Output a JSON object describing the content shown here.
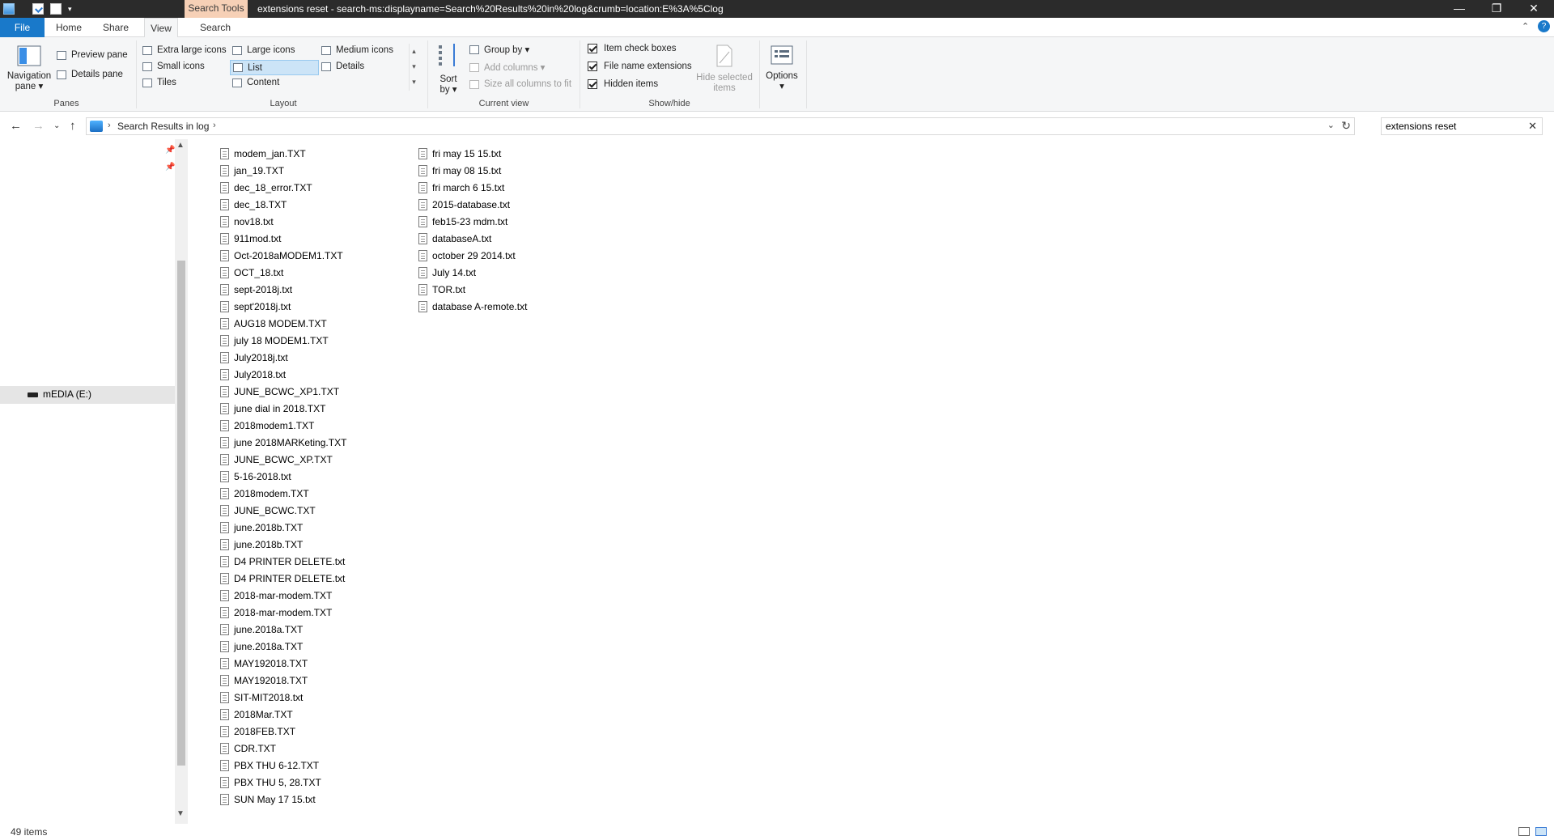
{
  "window": {
    "context_tab": "Search Tools",
    "title": "extensions reset - search-ms:displayname=Search%20Results%20in%20log&crumb=location:E%3A%5Clog",
    "minimize": "—",
    "restore": "❐",
    "close": "✕"
  },
  "tabs": {
    "file": "File",
    "home": "Home",
    "share": "Share",
    "view": "View",
    "search": "Search",
    "help": "?"
  },
  "ribbon": {
    "panes": {
      "navigation_pane": "Navigation",
      "navigation_pane2": "pane ▾",
      "preview_pane": "Preview pane",
      "details_pane": "Details pane",
      "label": "Panes"
    },
    "layout": {
      "extra_large_icons": "Extra large icons",
      "large_icons": "Large icons",
      "medium_icons": "Medium icons",
      "small_icons": "Small icons",
      "list": "List",
      "details": "Details",
      "tiles": "Tiles",
      "content": "Content",
      "label": "Layout"
    },
    "current_view": {
      "sort_by": "Sort",
      "sort_by2": "by ▾",
      "group_by": "Group by ▾",
      "add_columns": "Add columns ▾",
      "size_all_columns": "Size all columns to fit",
      "label": "Current view"
    },
    "show_hide": {
      "item_check_boxes": "Item check boxes",
      "file_name_extensions": "File name extensions",
      "hidden_items": "Hidden items",
      "hide_selected": "Hide selected",
      "hide_selected2": "items",
      "label": "Show/hide"
    },
    "options": {
      "label": "Options",
      "arrow": "▾"
    }
  },
  "address": {
    "crumb": "Search Results in log",
    "search_value": "extensions reset"
  },
  "navpane": {
    "drive": "mEDIA (E:)"
  },
  "files": {
    "col1": [
      "modem_jan.TXT",
      "jan_19.TXT",
      "dec_18_error.TXT",
      "dec_18.TXT",
      "nov18.txt",
      "911mod.txt",
      "Oct-2018aMODEM1.TXT",
      "OCT_18.txt",
      "sept-2018j.txt",
      "sept'2018j.txt",
      "AUG18 MODEM.TXT",
      "july 18 MODEM1.TXT",
      "July2018j.txt",
      "July2018.txt",
      "JUNE_BCWC_XP1.TXT",
      "june dial in 2018.TXT",
      "2018modem1.TXT",
      "june 2018MARKeting.TXT",
      "JUNE_BCWC_XP.TXT",
      "5-16-2018.txt",
      "2018modem.TXT",
      "JUNE_BCWC.TXT",
      "june.2018b.TXT",
      "june.2018b.TXT",
      "D4 PRINTER DELETE.txt",
      "D4 PRINTER DELETE.txt",
      "2018-mar-modem.TXT",
      "2018-mar-modem.TXT",
      "june.2018a.TXT",
      "june.2018a.TXT",
      "MAY192018.TXT",
      "MAY192018.TXT",
      "SIT-MIT2018.txt",
      "2018Mar.TXT",
      "2018FEB.TXT",
      "CDR.TXT",
      "PBX THU 6-12.TXT",
      "PBX THU 5, 28.TXT",
      "SUN May 17 15.txt"
    ],
    "col2": [
      "fri may 15 15.txt",
      "fri may 08 15.txt",
      "fri march 6 15.txt",
      "2015-database.txt",
      "feb15-23 mdm.txt",
      "databaseA.txt",
      "october 29 2014.txt",
      "July 14.txt",
      "TOR.txt",
      "database A-remote.txt"
    ]
  },
  "status": {
    "count": "49 items"
  }
}
